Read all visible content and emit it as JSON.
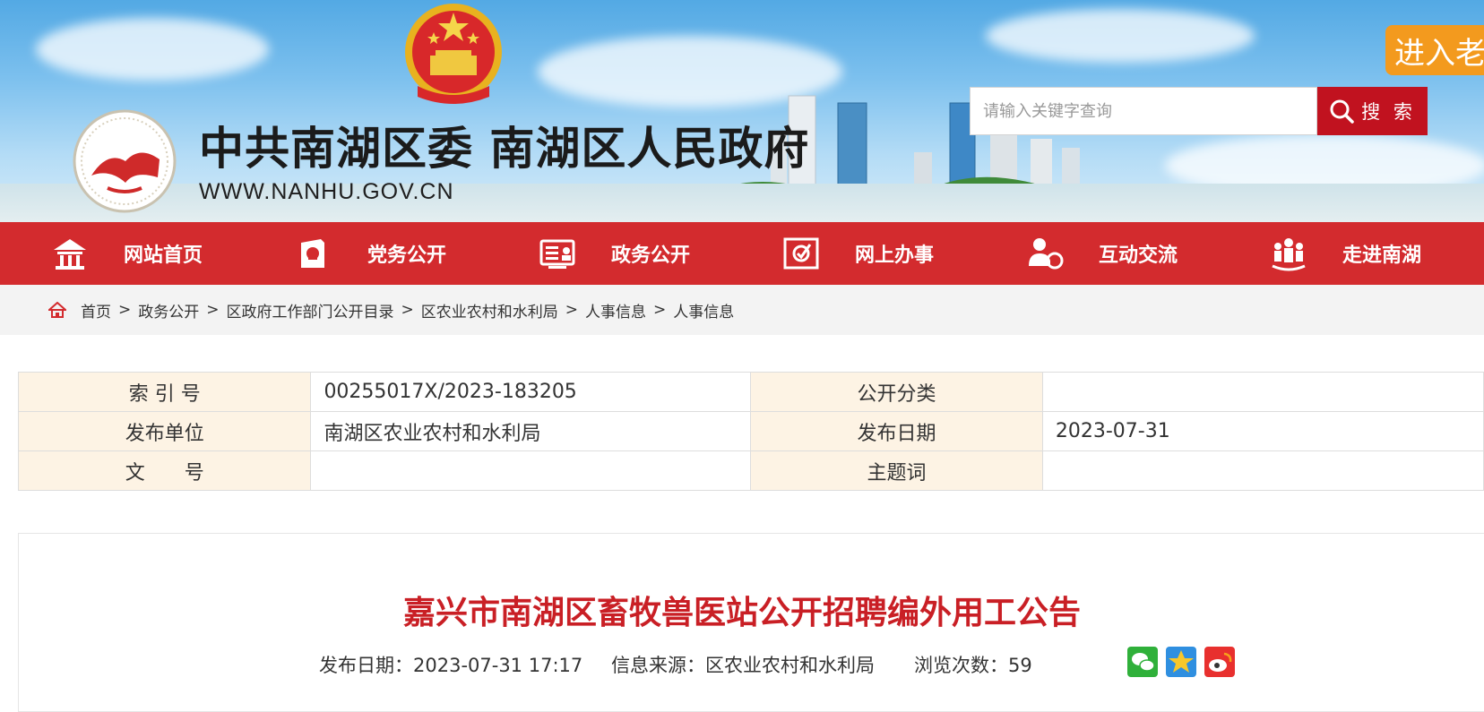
{
  "header": {
    "site_title": "中共南湖区委 南湖区人民政府",
    "site_url": "WWW.NANHU.GOV.CN",
    "search": {
      "placeholder": "请输入关键字查询",
      "button_label": "搜 索"
    },
    "elder_mode_label": "进入老"
  },
  "nav": {
    "items": [
      {
        "label": "网站首页",
        "icon": "home-icon"
      },
      {
        "label": "党务公开",
        "icon": "party-affairs-icon"
      },
      {
        "label": "政务公开",
        "icon": "government-affairs-icon"
      },
      {
        "label": "网上办事",
        "icon": "online-service-icon"
      },
      {
        "label": "互动交流",
        "icon": "interaction-icon"
      },
      {
        "label": "走进南湖",
        "icon": "people-icon"
      }
    ]
  },
  "breadcrumb": {
    "separator": ">",
    "items": [
      "首页",
      "政务公开",
      "区政府工作部门公开目录",
      "区农业农村和水利局",
      "人事信息",
      "人事信息"
    ]
  },
  "info_table": {
    "rows": [
      {
        "label1": "索 引 号",
        "value1": "00255017X/2023-183205",
        "label2": "公开分类",
        "value2": ""
      },
      {
        "label1": "发布单位",
        "value1": "南湖区农业农村和水利局",
        "label2": "发布日期",
        "value2": "2023-07-31"
      },
      {
        "label1": "文　　号",
        "value1": "",
        "label2": "主题词",
        "value2": ""
      }
    ]
  },
  "article": {
    "title": "嘉兴市南湖区畜牧兽医站公开招聘编外用工公告",
    "meta": {
      "publish_date": "发布日期：2023-07-31 17:17",
      "source": "信息来源：区农业农村和水利局",
      "views": "浏览次数：59"
    },
    "share_icons": [
      "wechat-icon",
      "favorite-star-icon",
      "weibo-icon"
    ]
  },
  "colors": {
    "nav_red": "#d32b2e",
    "title_red": "#c91f25",
    "search_button": "#c1121f",
    "elder_button": "#f39a1e",
    "table_label_bg": "#fdf3e4"
  }
}
